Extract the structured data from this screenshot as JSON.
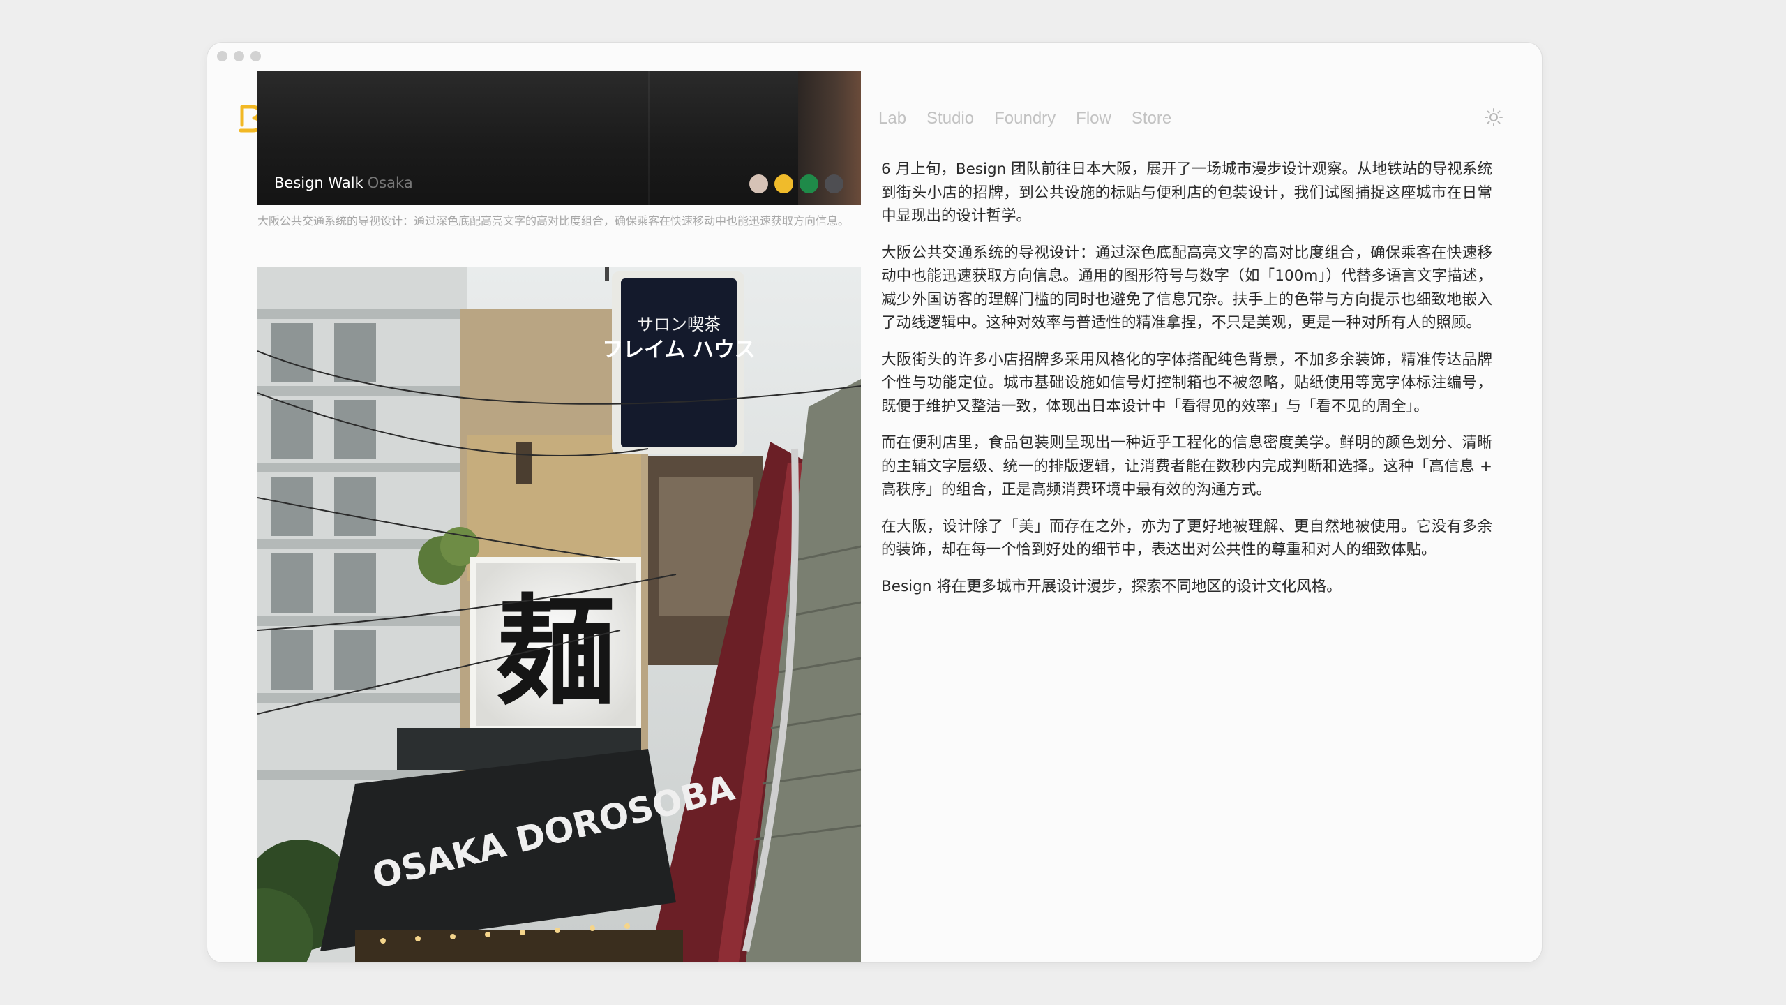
{
  "hero": {
    "title": "Besign Walk",
    "subtitle": "Osaka",
    "swatches": [
      "#d6c2b6",
      "#f0bb2b",
      "#1f8a49",
      "#4e4e52"
    ]
  },
  "caption": "大阪公共交通系统的导视设计：通过深色底配高亮文字的高对比度组合，确保乘客在快速移动中也能迅速获取方向信息。",
  "photo": {
    "sign_katakana_top": "サロン喫茶",
    "sign_katakana_main": "フレイム ハウス",
    "sign_kanji": "麺",
    "awning_text": "OSAKA DOROSOBA"
  },
  "nav": {
    "items": [
      "Lab",
      "Studio",
      "Foundry",
      "Flow",
      "Store"
    ]
  },
  "article": {
    "paragraphs": [
      "6 月上旬，Besign 团队前往日本大阪，展开了一场城市漫步设计观察。从地铁站的导视系统到街头小店的招牌，到公共设施的标贴与便利店的包装设计，我们试图捕捉这座城市在日常中显现出的设计哲学。",
      "大阪公共交通系统的导视设计：通过深色底配高亮文字的高对比度组合，确保乘客在快速移动中也能迅速获取方向信息。通用的图形符号与数字（如「100m」）代替多语言文字描述，减少外国访客的理解门槛的同时也避免了信息冗杂。扶手上的色带与方向提示也细致地嵌入了动线逻辑中。这种对效率与普适性的精准拿捏，不只是美观，更是一种对所有人的照顾。",
      "大阪街头的许多小店招牌多采用风格化的字体搭配纯色背景，不加多余装饰，精准传达品牌个性与功能定位。城市基础设施如信号灯控制箱也不被忽略，贴纸使用等宽字体标注编号，既便于维护又整洁一致，体现出日本设计中「看得见的效率」与「看不见的周全」。",
      "而在便利店里，食品包装则呈现出一种近乎工程化的信息密度美学。鲜明的颜色划分、清晰的主辅文字层级、统一的排版逻辑，让消费者能在数秒内完成判断和选择。这种「高信息 + 高秩序」的组合，正是高频消费环境中最有效的沟通方式。",
      "在大阪，设计除了「美」而存在之外，亦为了更好地被理解、更自然地被使用。它没有多余的装饰，却在每一个恰到好处的细节中，表达出对公共性的尊重和对人的细致体贴。",
      "Besign 将在更多城市开展设计漫步，探索不同地区的设计文化风格。"
    ]
  },
  "colors": {
    "accent": "#f2b824",
    "nav_text": "#c2c2c2",
    "body_text": "#2b2b2b",
    "caption_text": "#a7a7a7"
  }
}
